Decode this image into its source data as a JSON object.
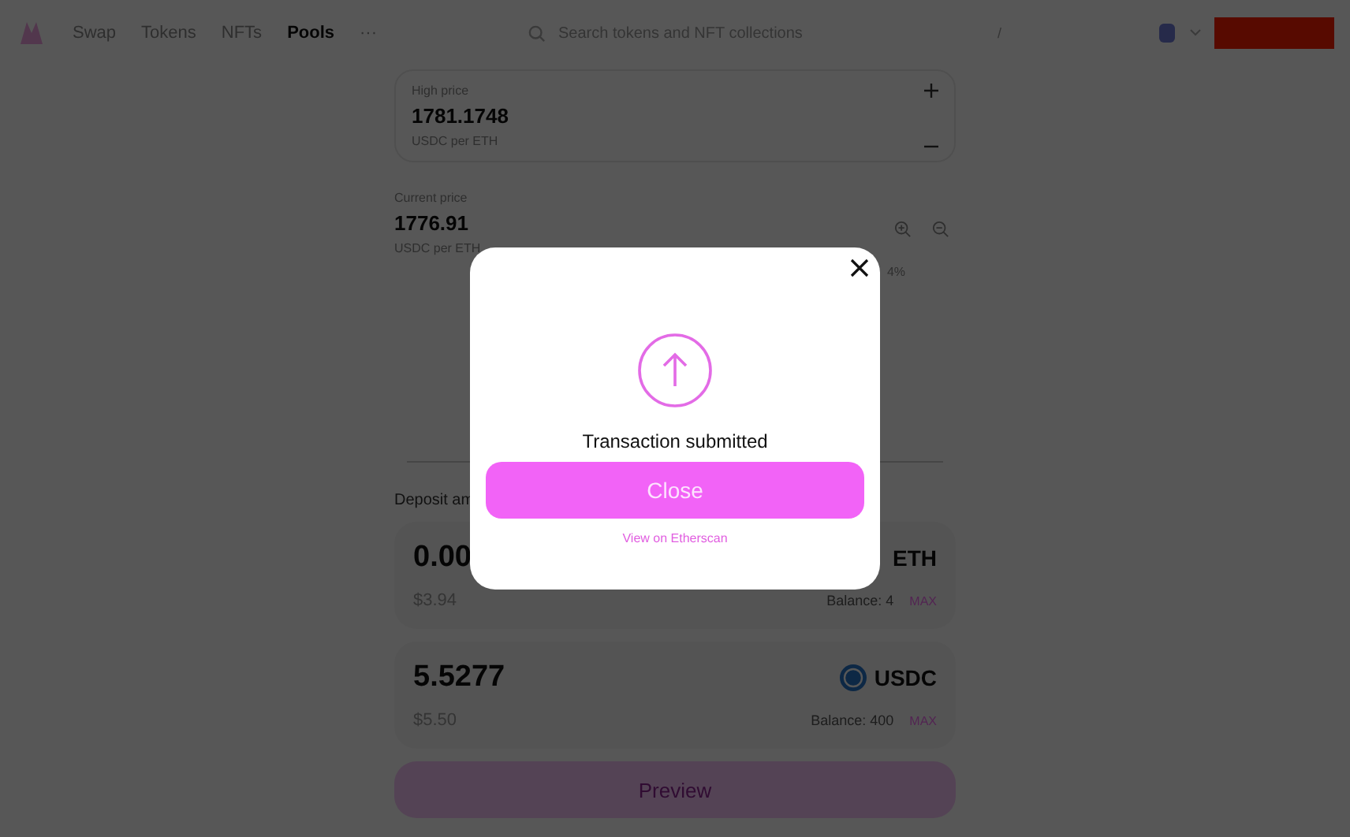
{
  "nav": {
    "items": [
      {
        "label": "Swap",
        "selected": false
      },
      {
        "label": "Tokens",
        "selected": false
      },
      {
        "label": "NFTs",
        "selected": false
      },
      {
        "label": "Pools",
        "selected": true
      }
    ],
    "more": "···",
    "search": {
      "placeholder": "Search tokens and NFT collections",
      "shortcut": "/"
    }
  },
  "high_price": {
    "label": "High price",
    "value": "1781.1748",
    "unit": "USDC per ETH"
  },
  "current_price": {
    "label": "Current price",
    "value": "1776.91",
    "unit": "USDC per ETH"
  },
  "chart": {
    "range_label": "4%"
  },
  "deposit": {
    "title": "Deposit am",
    "tokens": [
      {
        "amount": "0.00",
        "symbol": "ETH",
        "usd": "$3.94",
        "balance": "Balance: 4",
        "max": "MAX",
        "show_icon": false
      },
      {
        "amount": "5.5277",
        "symbol": "USDC",
        "usd": "$5.50",
        "balance": "Balance: 400",
        "max": "MAX",
        "show_icon": true
      }
    ]
  },
  "preview": "Preview",
  "modal": {
    "title": "Transaction submitted",
    "button": "Close",
    "link": "View on Etherscan"
  }
}
